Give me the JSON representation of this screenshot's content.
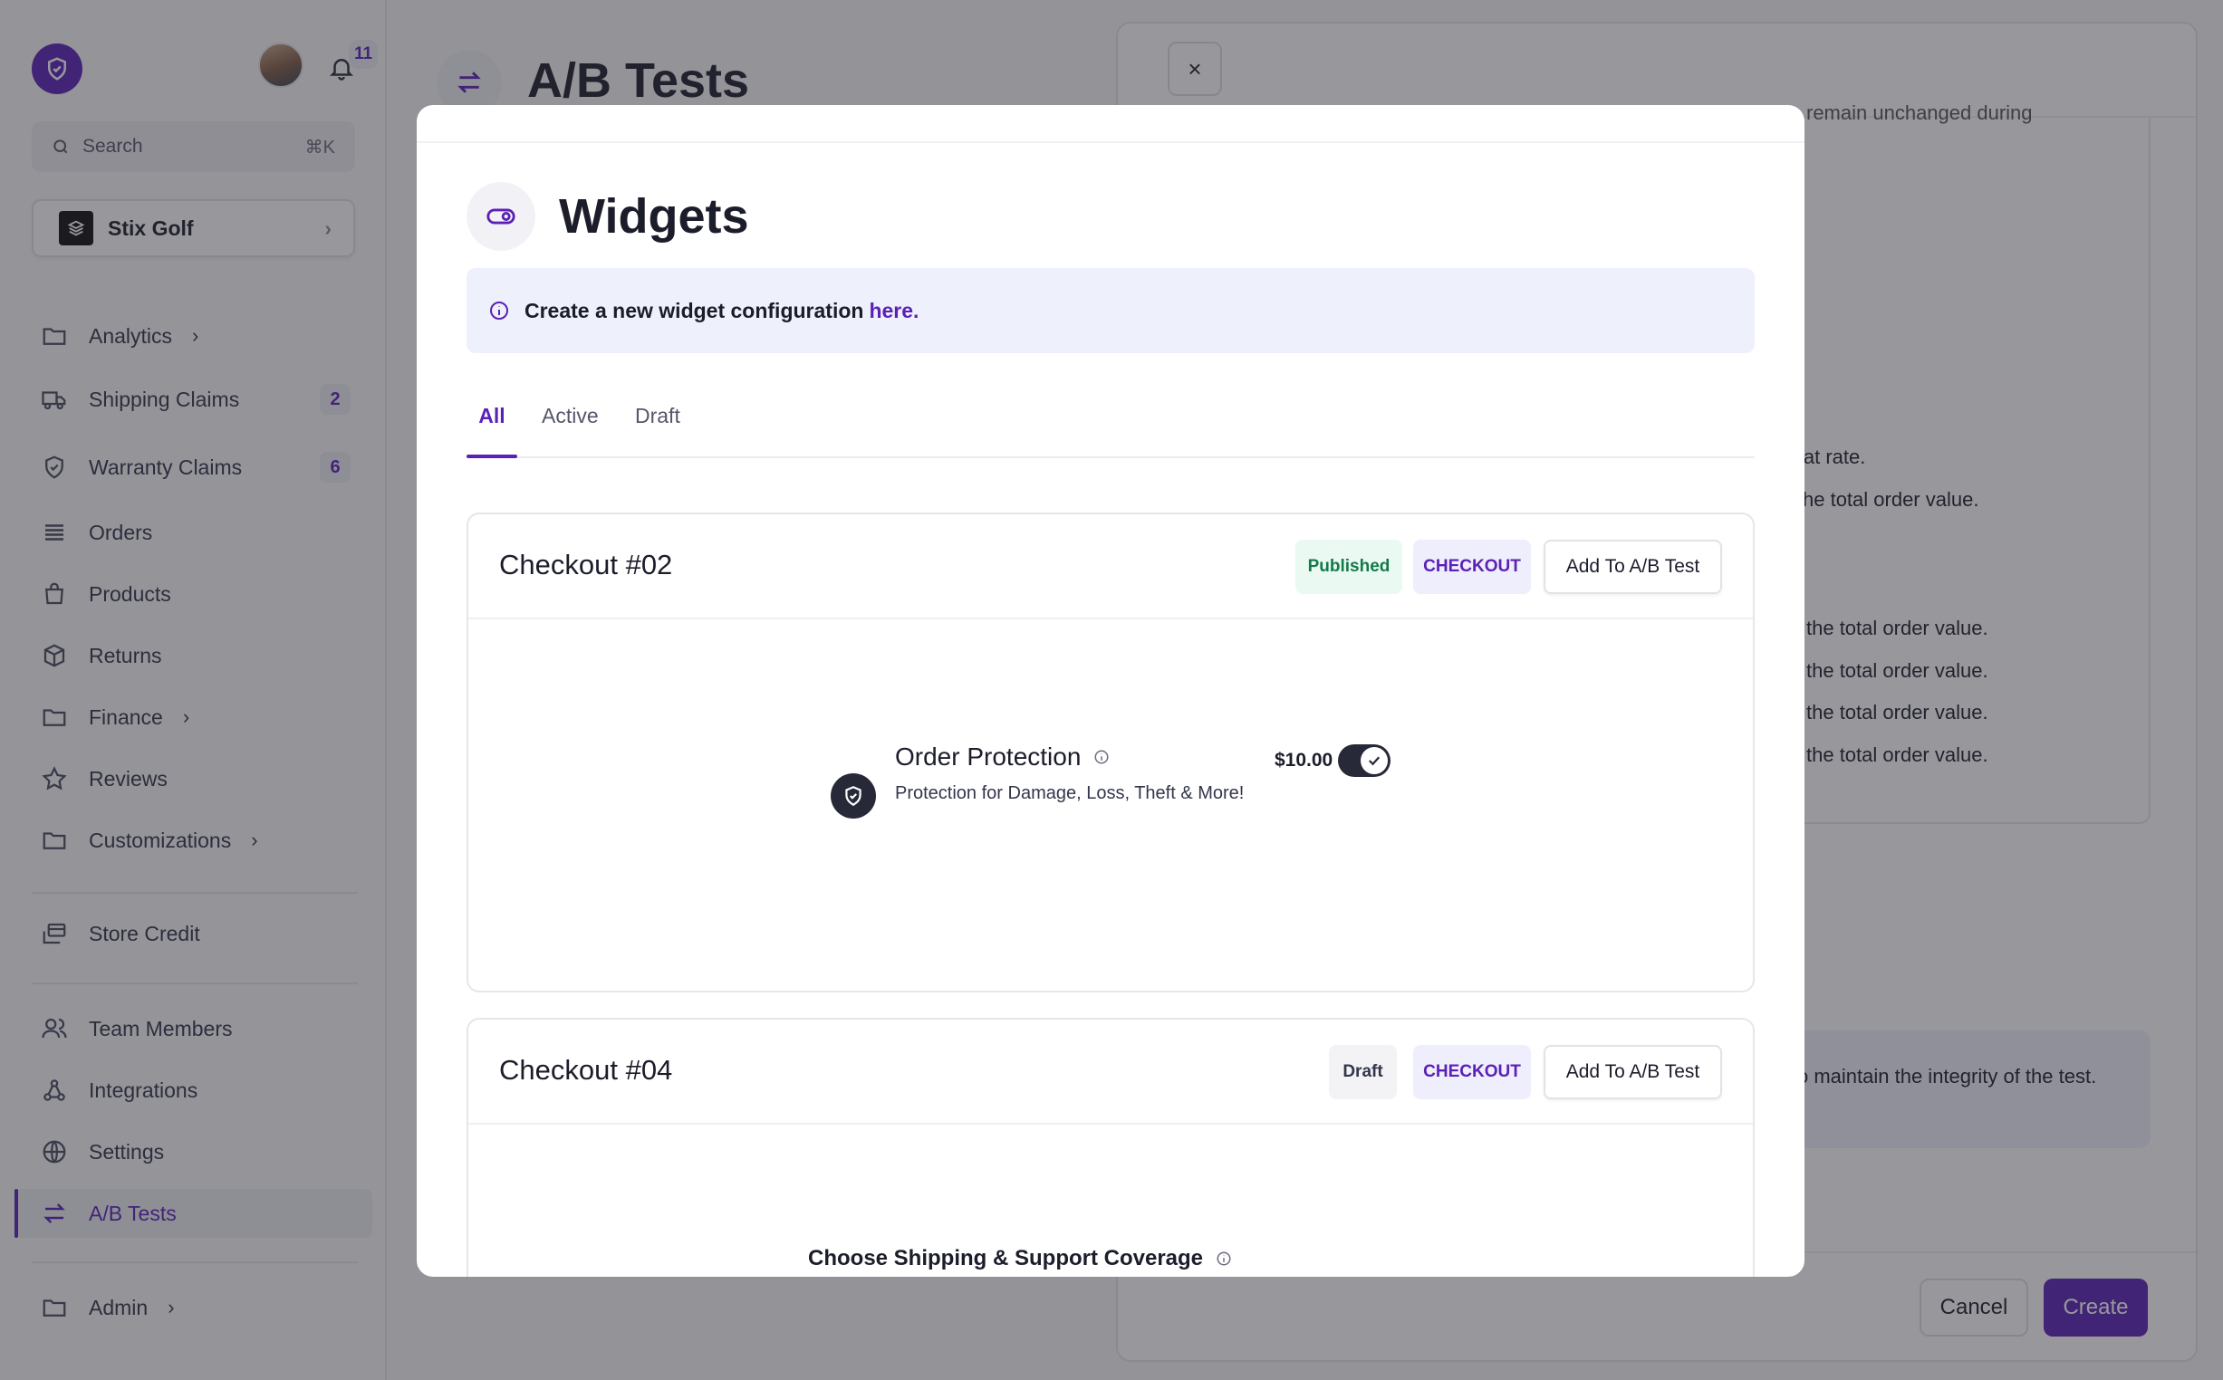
{
  "sidebar": {
    "notification_count": "11",
    "search_placeholder": "Search",
    "search_shortcut": "⌘K",
    "store_name": "Stix Golf",
    "items": [
      {
        "label": "Analytics"
      },
      {
        "label": "Shipping Claims",
        "count": "2"
      },
      {
        "label": "Warranty Claims",
        "count": "6"
      },
      {
        "label": "Orders"
      },
      {
        "label": "Products"
      },
      {
        "label": "Returns"
      },
      {
        "label": "Finance"
      },
      {
        "label": "Reviews"
      },
      {
        "label": "Customizations"
      },
      {
        "label": "Store Credit"
      },
      {
        "label": "Team Members"
      },
      {
        "label": "Integrations"
      },
      {
        "label": "Settings"
      },
      {
        "label": "A/B Tests"
      },
      {
        "label": "Admin"
      }
    ]
  },
  "page": {
    "title": "A/B Tests"
  },
  "drawer": {
    "close_symbol": "×",
    "lines": [
      "remain unchanged during",
      "lat rate.",
      "he total order value.",
      "the total order value.",
      "the total order value.",
      "the total order value.",
      "the total order value."
    ],
    "info_text": "o maintain the integrity of the test.",
    "cancel_label": "Cancel",
    "create_label": "Create"
  },
  "modal": {
    "title": "Widgets",
    "info_text": "Create a new widget configuration",
    "info_link": "here.",
    "tabs": [
      "All",
      "Active",
      "Draft"
    ],
    "cards": [
      {
        "title": "Checkout #02",
        "status": "Published",
        "type": "CHECKOUT",
        "action": "Add To A/B Test",
        "preview": {
          "title": "Order Protection",
          "description": "Protection for Damage, Loss, Theft & More!",
          "price": "$10.00",
          "enabled": true
        }
      },
      {
        "title": "Checkout #04",
        "status": "Draft",
        "type": "CHECKOUT",
        "action": "Add To A/B Test",
        "preview": {
          "title": "Choose Shipping & Support Coverage"
        }
      }
    ]
  },
  "colors": {
    "accent": "#5b21b6",
    "published_bg": "#eafaf2",
    "published_text": "#147a4a",
    "info_bg": "#eef0fb"
  },
  "icons": {
    "logo": "shield-check-icon",
    "bell": "bell-icon",
    "search": "search-icon",
    "page": "arrows-swap-icon",
    "modal": "toggle-icon",
    "info": "info-circle-icon"
  }
}
